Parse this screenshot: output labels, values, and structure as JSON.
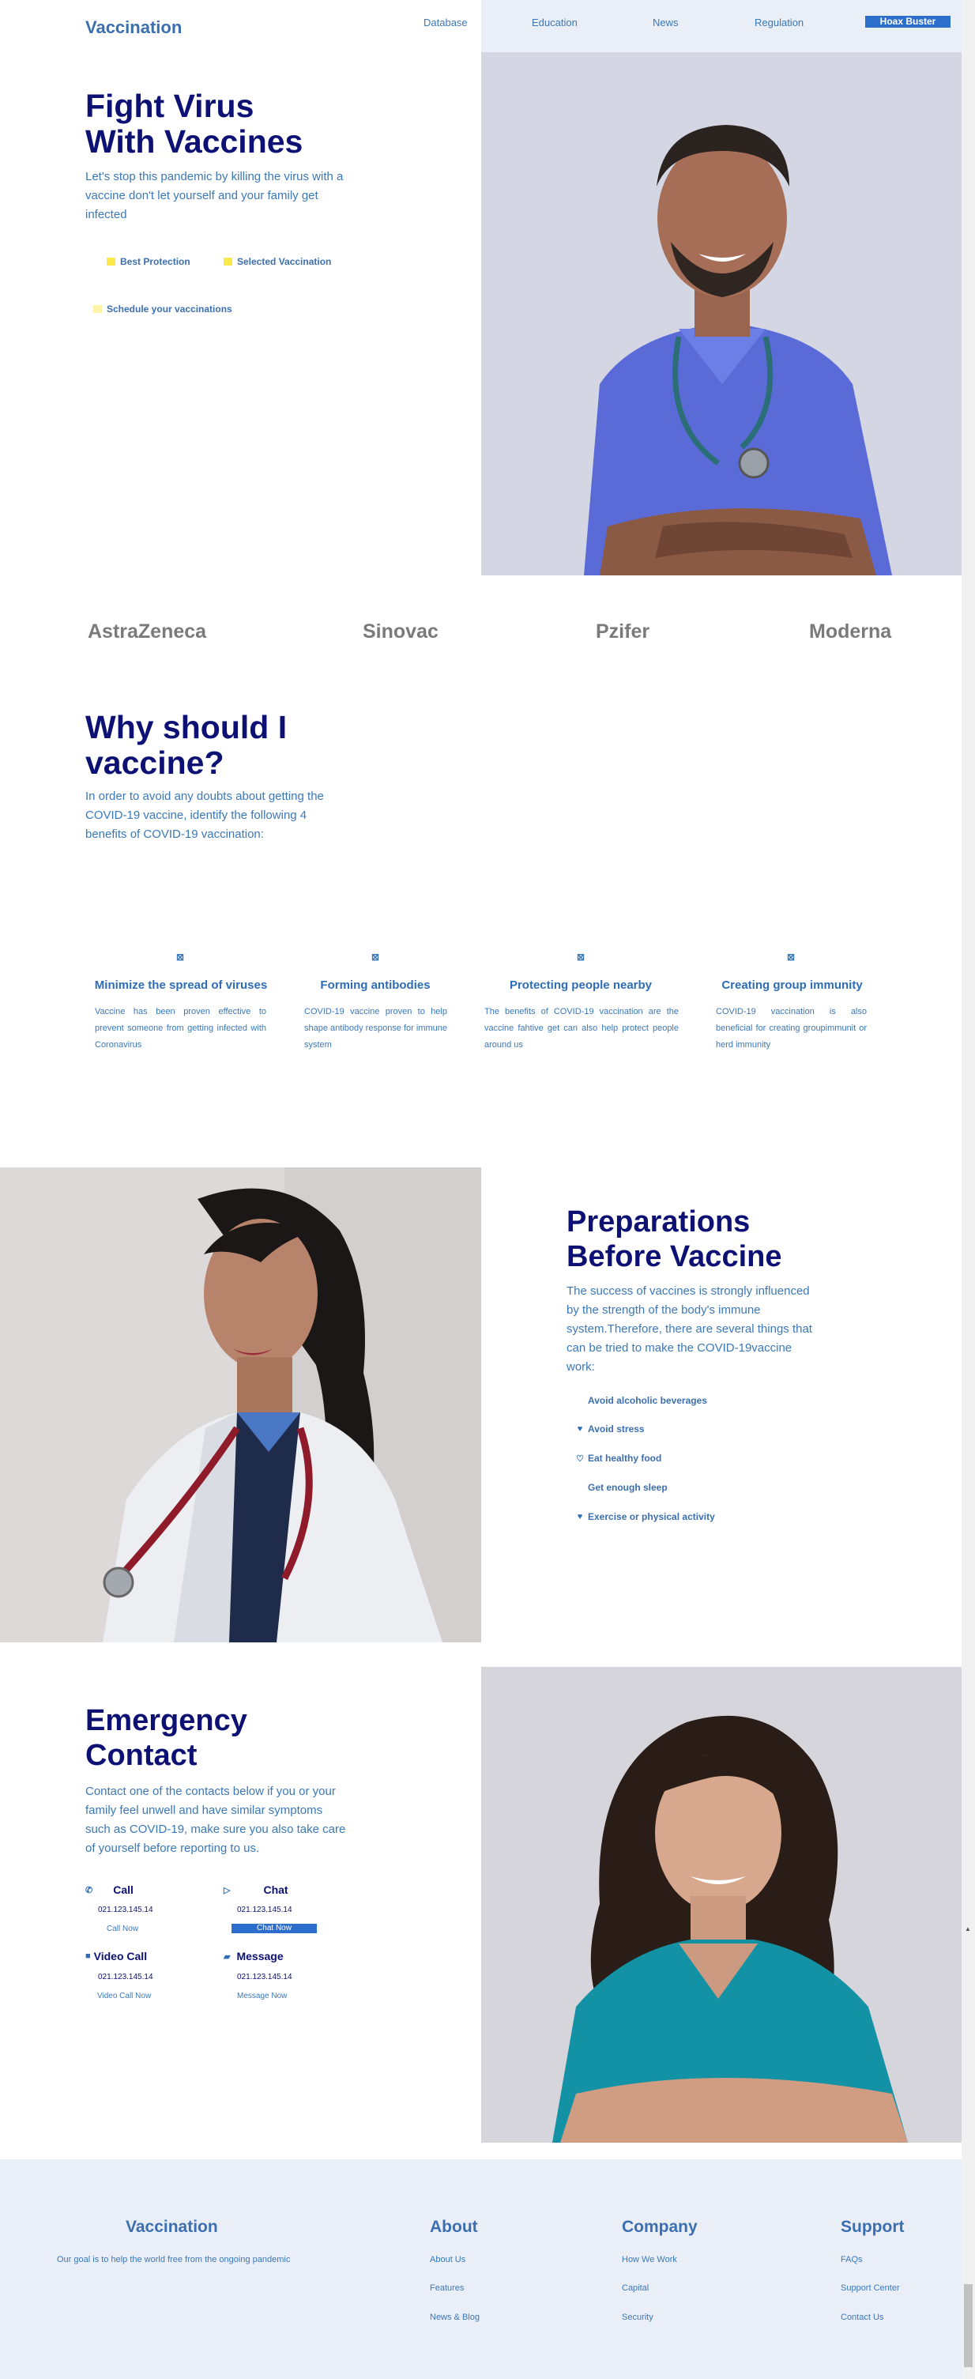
{
  "header": {
    "logo": "Vaccination",
    "nav": [
      "Database",
      "Education",
      "News",
      "Regulation"
    ],
    "cta": "Hoax Buster"
  },
  "hero": {
    "title_line1": "Fight Virus",
    "title_line2": "With Vaccines",
    "description": "Let's stop this pandemic by killing the virus with a vaccine don't let yourself and your family get infected",
    "features": [
      "Best Protection",
      "Selected Vaccination",
      "Schedule your vaccinations"
    ]
  },
  "brands": [
    "AstraZeneca",
    "Sinovac",
    "Pzifer",
    "Moderna"
  ],
  "why": {
    "title_line1": "Why should I",
    "title_line2": "vaccine?",
    "description": "In order to avoid any doubts about getting the COVID-19 vaccine, identify the following 4 benefits of COVID-19 vaccination:",
    "cards": [
      {
        "icon": "broken-image-icon",
        "title": "Minimize the spread of viruses",
        "text": "Vaccine has been proven effective to prevent someone from getting infected with Coronavirus"
      },
      {
        "icon": "broken-image-icon",
        "title": "Forming antibodies",
        "text": "COVID-19 vaccine proven to help shape antibody response for immune system"
      },
      {
        "icon": "broken-image-icon",
        "title": "Protecting people nearby",
        "text": "The benefits of COVID-19 vaccination are the vaccine fahtive get can also help protect people around us"
      },
      {
        "icon": "broken-image-icon",
        "title": "Creating group immunity",
        "text": "COVID-19 vaccination is also beneficial for creating groupimmunit or herd immunity"
      }
    ]
  },
  "preparations": {
    "title_line1": "Preparations",
    "title_line2": "Before Vaccine",
    "description": "The success of vaccines is strongly influenced by the strength of the body's immune system.Therefore, there are several things that can be tried to make the COVID-19vaccine work:",
    "items": [
      {
        "icon": "none",
        "label": "Avoid alcoholic beverages"
      },
      {
        "icon": "heart-icon",
        "label": "Avoid stress"
      },
      {
        "icon": "heart-icon",
        "label": "Eat healthy food"
      },
      {
        "icon": "none",
        "label": "Get enough sleep"
      },
      {
        "icon": "heart-icon",
        "label": "Exercise or physical activity"
      }
    ]
  },
  "emergency": {
    "title_line1": "Emergency",
    "title_line2": "Contact",
    "description": "Contact one of the contacts below if you or your family feel unwell and have similar symptoms such as COVID-19, make sure you also take care of yourself before reporting to us.",
    "contacts": [
      {
        "icon": "phone-icon",
        "label": "Call",
        "number": "021.123.145.14",
        "action": "Call Now"
      },
      {
        "icon": "chat-icon",
        "label": "Chat",
        "number": "021.123.145.14",
        "action": "Chat Now"
      },
      {
        "icon": "video-icon",
        "label": "Video Call",
        "number": "021.123.145.14",
        "action": "Video Call Now"
      },
      {
        "icon": "message-icon",
        "label": "Message",
        "number": "021.123.145.14",
        "action": "Message Now"
      }
    ]
  },
  "footer": {
    "brand": {
      "title": "Vaccination",
      "tagline": "Our goal is to help the world free from the ongoing pandemic"
    },
    "columns": [
      {
        "title": "About",
        "links": [
          "About Us",
          "Features",
          "News & Blog"
        ]
      },
      {
        "title": "Company",
        "links": [
          "How We Work",
          "Capital",
          "Security"
        ]
      },
      {
        "title": "Support",
        "links": [
          "FAQs",
          "Support Center",
          "Contact Us"
        ]
      }
    ]
  },
  "colors": {
    "navy": "#0d1173",
    "accent_blue": "#2c6ecb",
    "text_blue": "#3b78b8",
    "light_bg": "#e9eef7",
    "yellow": "#fbe84a"
  }
}
